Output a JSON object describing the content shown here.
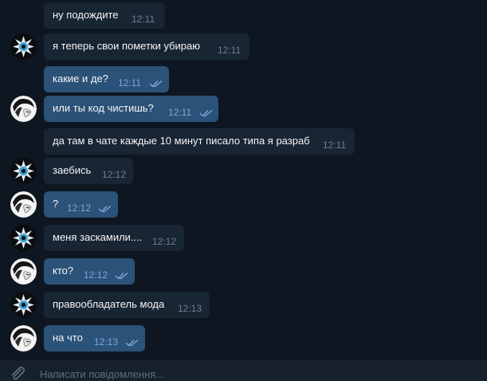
{
  "messages": [
    {
      "id": "m1",
      "direction": "in",
      "text": "ну подождите",
      "time": "12:11",
      "avatar": null
    },
    {
      "id": "m2",
      "direction": "in",
      "text": "я теперь свои пометки убираю",
      "time": "12:11",
      "avatar": "cat-icon"
    },
    {
      "id": "m3",
      "direction": "out",
      "text": "какие и де?",
      "time": "12:11",
      "read": true,
      "avatar": null
    },
    {
      "id": "m4",
      "direction": "out",
      "text": "или ты код чистишь?",
      "time": "12:11",
      "read": true,
      "avatar": "anime-icon"
    },
    {
      "id": "m5",
      "direction": "in",
      "text": "да там в чате каждые 10 минут писало типа я разраб",
      "time": "12:11",
      "avatar": null
    },
    {
      "id": "m6",
      "direction": "in",
      "text": "заебись",
      "time": "12:12",
      "avatar": "cat-icon"
    },
    {
      "id": "m7",
      "direction": "out",
      "text": "?",
      "time": "12:12",
      "read": true,
      "avatar": "anime-icon"
    },
    {
      "id": "m8",
      "direction": "in",
      "text": "меня заскамили....",
      "time": "12:12",
      "avatar": "cat-icon"
    },
    {
      "id": "m9",
      "direction": "out",
      "text": "кто?",
      "time": "12:12",
      "read": true,
      "avatar": "anime-icon"
    },
    {
      "id": "m10",
      "direction": "in",
      "text": "правообладатель мода",
      "time": "12:13",
      "avatar": "cat-icon"
    },
    {
      "id": "m11",
      "direction": "out",
      "text": "на что",
      "time": "12:13",
      "read": true,
      "avatar": "anime-icon"
    }
  ],
  "composer": {
    "placeholder": "Написати повідомлення...",
    "attach_icon": "paperclip-icon"
  },
  "colors": {
    "background": "#0e1621",
    "incoming_bubble": "#182533",
    "outgoing_bubble": "#2b5278",
    "read_ticks": "#7da8d3"
  }
}
